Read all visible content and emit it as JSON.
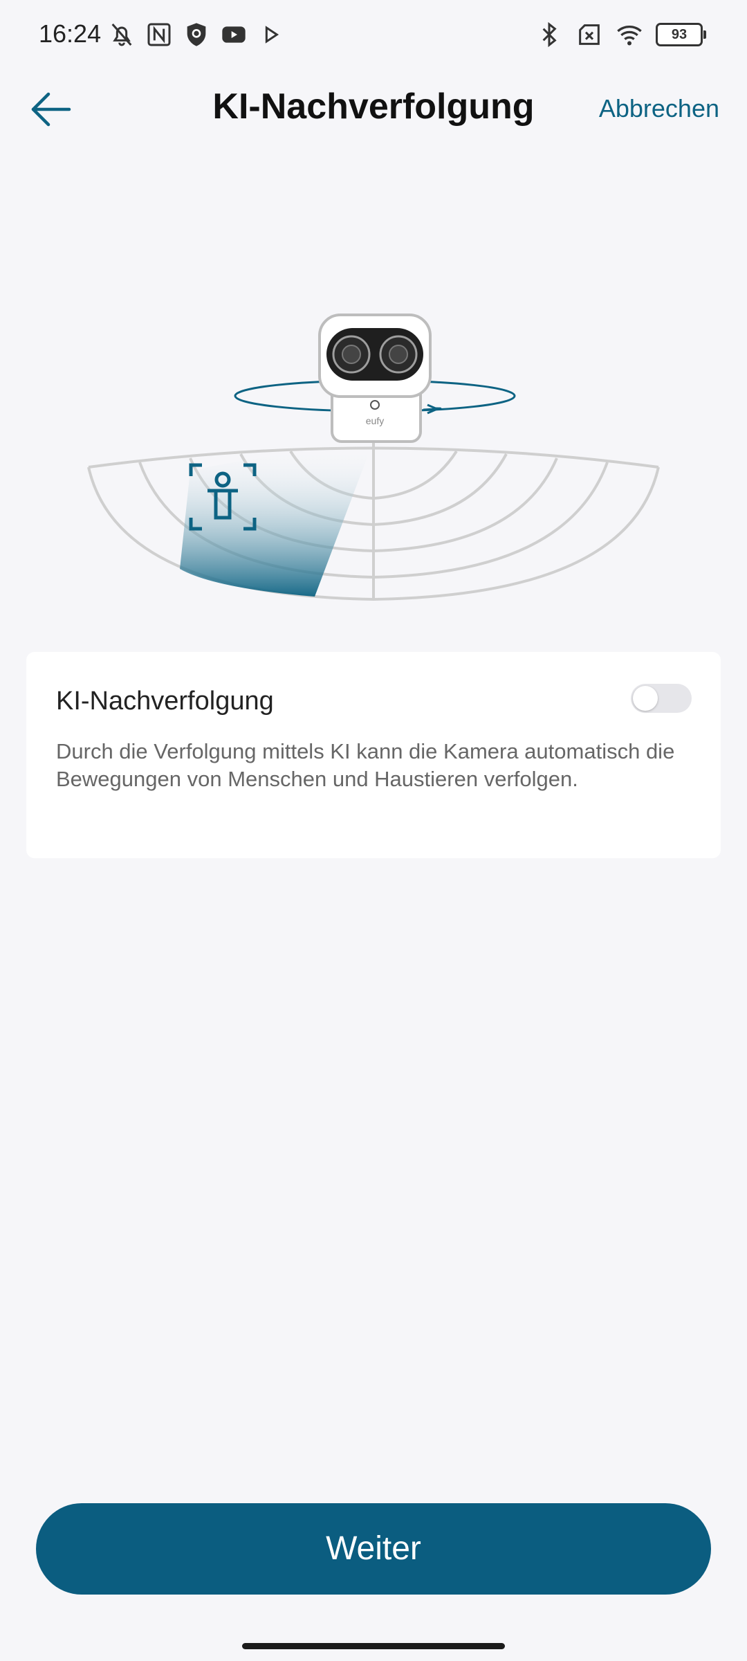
{
  "status_bar": {
    "time": "16:24",
    "battery_level": "93",
    "left_icons": [
      "muted-bell-icon",
      "nfc-icon",
      "shield-icon",
      "youtube-icon",
      "play-store-icon"
    ],
    "right_icons": [
      "bluetooth-icon",
      "no-sim-icon",
      "wifi-icon",
      "battery-icon"
    ]
  },
  "header": {
    "title": "KI-Nachverfolgung",
    "cancel_label": "Abbrechen",
    "back_icon": "arrow-left-icon"
  },
  "illustration": {
    "brand_text": "eufy",
    "accent_color": "#0d6383"
  },
  "card": {
    "title": "KI-Nachverfolgung",
    "description": "Durch die Verfolgung mittels KI kann die Kamera automatisch die Bewegungen von Menschen und Haustieren verfolgen.",
    "toggle_on": false
  },
  "footer": {
    "next_label": "Weiter"
  },
  "colors": {
    "primary": "#0b5d80",
    "accent": "#0d6383",
    "background": "#f6f6f9"
  }
}
